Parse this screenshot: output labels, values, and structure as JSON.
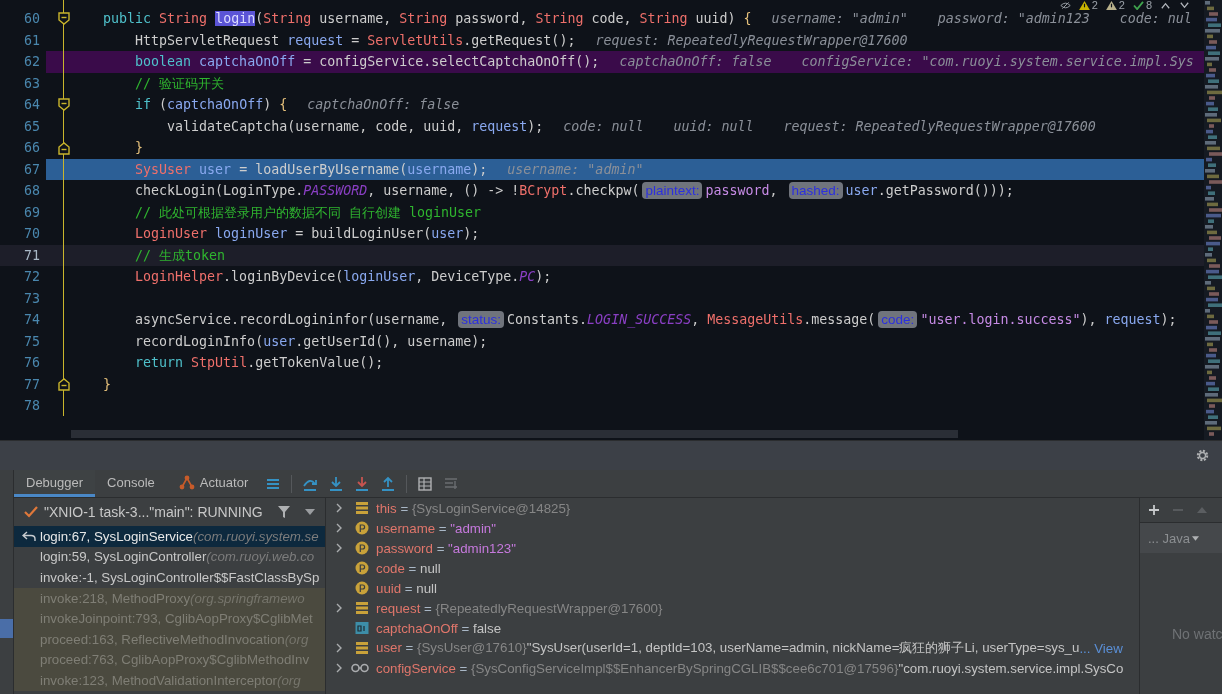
{
  "editor": {
    "inspections": [
      {
        "kind": "warning",
        "count": "2"
      },
      {
        "kind": "weak",
        "count": "2"
      },
      {
        "kind": "ok",
        "count": "8"
      }
    ],
    "lines": [
      {
        "number": "60",
        "fold_marker": {
          "kind": "start"
        },
        "segments": [
          {
            "kind": "code",
            "tokens": [
              {
                "text": "    public ",
                "kind": "kw"
              },
              {
                "text": "String ",
                "kind": "type"
              },
              {
                "text": "login",
                "kind": "sel"
              },
              {
                "text": "(",
                "kind": "p"
              },
              {
                "text": "String",
                "kind": "type"
              },
              {
                "text": " username, ",
                "kind": "p"
              },
              {
                "text": "String",
                "kind": "type"
              },
              {
                "text": " password, ",
                "kind": "p"
              },
              {
                "text": "String",
                "kind": "type"
              },
              {
                "text": " code, ",
                "kind": "p"
              },
              {
                "text": "String",
                "kind": "type"
              },
              {
                "text": " uuid) ",
                "kind": "p"
              },
              {
                "text": "{",
                "kind": "brace"
              }
            ]
          },
          {
            "kind": "value",
            "text": "username: \"admin\""
          },
          {
            "kind": "value",
            "text": "password: \"admin123"
          },
          {
            "kind": "value",
            "text": "code: nul"
          }
        ]
      },
      {
        "number": "61",
        "segments": [
          {
            "kind": "code",
            "tokens": [
              {
                "text": "        HttpServletRequest ",
                "kind": "p"
              },
              {
                "text": "request",
                "kind": "var"
              },
              {
                "text": " = ",
                "kind": "p"
              },
              {
                "text": "ServletUtils",
                "kind": "type"
              },
              {
                "text": ".getRequest();",
                "kind": "p"
              }
            ]
          },
          {
            "kind": "value",
            "text": "request: RepeatedlyRequestWrapper@17600"
          }
        ]
      },
      {
        "number": "62",
        "highlight": {
          "kind": "breakpoint"
        },
        "segments": [
          {
            "kind": "code",
            "tokens": [
              {
                "text": "        boolean ",
                "kind": "kw"
              },
              {
                "text": "captchaOnOff",
                "kind": "var"
              },
              {
                "text": " = configService.selectCaptchaOnOff();",
                "kind": "p"
              }
            ]
          },
          {
            "kind": "value",
            "text": "captchaOnOff: false"
          },
          {
            "kind": "value",
            "text": "configService: \"com.ruoyi.system.service.impl.Sys"
          }
        ]
      },
      {
        "number": "63",
        "segments": [
          {
            "kind": "code",
            "tokens": [
              {
                "text": "        // 验证码开关",
                "kind": "comment"
              }
            ]
          }
        ]
      },
      {
        "number": "64",
        "fold_marker": {
          "kind": "start"
        },
        "segments": [
          {
            "kind": "code",
            "tokens": [
              {
                "text": "        if",
                "kind": "kw"
              },
              {
                "text": " (",
                "kind": "p"
              },
              {
                "text": "captchaOnOff",
                "kind": "var"
              },
              {
                "text": ") ",
                "kind": "p"
              },
              {
                "text": "{",
                "kind": "brace"
              }
            ]
          },
          {
            "kind": "value",
            "text": "captchaOnOff: false"
          }
        ]
      },
      {
        "number": "65",
        "segments": [
          {
            "kind": "code",
            "tokens": [
              {
                "text": "            validateCaptcha(username, code, uuid, ",
                "kind": "p"
              },
              {
                "text": "request",
                "kind": "var"
              },
              {
                "text": ");",
                "kind": "p"
              }
            ]
          },
          {
            "kind": "value",
            "text": "code: null"
          },
          {
            "kind": "value",
            "text": "uuid: null"
          },
          {
            "kind": "value",
            "text": "request: RepeatedlyRequestWrapper@17600"
          }
        ]
      },
      {
        "number": "66",
        "fold_marker": {
          "kind": "end"
        },
        "segments": [
          {
            "kind": "code",
            "tokens": [
              {
                "text": "        }",
                "kind": "brace"
              }
            ]
          }
        ]
      },
      {
        "number": "67",
        "highlight": {
          "kind": "execution"
        },
        "segments": [
          {
            "kind": "code",
            "tokens": [
              {
                "text": "        SysUser ",
                "kind": "type"
              },
              {
                "text": "user",
                "kind": "var"
              },
              {
                "text": " = loadUserByUsername(",
                "kind": "p"
              },
              {
                "text": "username",
                "kind": "var"
              },
              {
                "text": ");",
                "kind": "p"
              }
            ]
          },
          {
            "kind": "value",
            "text": "username: \"admin\""
          }
        ]
      },
      {
        "number": "68",
        "segments": [
          {
            "kind": "code",
            "tokens": [
              {
                "text": "        checkLogin(LoginType.",
                "kind": "p"
              },
              {
                "text": "PASSWORD",
                "kind": "const"
              },
              {
                "text": ", username, () -> !",
                "kind": "p"
              },
              {
                "text": "BCrypt",
                "kind": "type"
              },
              {
                "text": ".checkpw(",
                "kind": "p"
              }
            ]
          },
          {
            "kind": "hint",
            "text": "plaintext:"
          },
          {
            "kind": "code",
            "tokens": [
              {
                "text": "password",
                "kind": "str"
              },
              {
                "text": ", ",
                "kind": "p"
              }
            ]
          },
          {
            "kind": "hint",
            "text": "hashed:"
          },
          {
            "kind": "code",
            "tokens": [
              {
                "text": "user",
                "kind": "var"
              },
              {
                "text": ".getPassword()));",
                "kind": "p"
              }
            ]
          }
        ]
      },
      {
        "number": "69",
        "segments": [
          {
            "kind": "code",
            "tokens": [
              {
                "text": "        // 此处可根据登录用户的数据不同 自行创建 loginUser",
                "kind": "comment"
              }
            ]
          }
        ]
      },
      {
        "number": "70",
        "segments": [
          {
            "kind": "code",
            "tokens": [
              {
                "text": "        LoginUser ",
                "kind": "type"
              },
              {
                "text": "loginUser",
                "kind": "var"
              },
              {
                "text": " = buildLoginUser(",
                "kind": "p"
              },
              {
                "text": "user",
                "kind": "var"
              },
              {
                "text": ");",
                "kind": "p"
              }
            ]
          }
        ]
      },
      {
        "number": "71",
        "highlight": {
          "kind": "caret"
        },
        "segments": [
          {
            "kind": "code",
            "tokens": [
              {
                "text": "        // 生成token",
                "kind": "comment"
              }
            ]
          }
        ]
      },
      {
        "number": "72",
        "segments": [
          {
            "kind": "code",
            "tokens": [
              {
                "text": "        LoginHelper",
                "kind": "type"
              },
              {
                "text": ".loginByDevice(",
                "kind": "p"
              },
              {
                "text": "loginUser",
                "kind": "var"
              },
              {
                "text": ", DeviceType.",
                "kind": "p"
              },
              {
                "text": "PC",
                "kind": "const"
              },
              {
                "text": ");",
                "kind": "p"
              }
            ]
          }
        ]
      },
      {
        "number": "73"
      },
      {
        "number": "74",
        "segments": [
          {
            "kind": "code",
            "tokens": [
              {
                "text": "        asyncService.recordLogininfor(username, ",
                "kind": "p"
              }
            ]
          },
          {
            "kind": "hint",
            "text": "status:"
          },
          {
            "kind": "code",
            "tokens": [
              {
                "text": "Constants.",
                "kind": "p"
              },
              {
                "text": "LOGIN_SUCCESS",
                "kind": "const"
              },
              {
                "text": ", ",
                "kind": "p"
              },
              {
                "text": "MessageUtils",
                "kind": "type"
              },
              {
                "text": ".message(",
                "kind": "p"
              }
            ]
          },
          {
            "kind": "hint",
            "text": "code:"
          },
          {
            "kind": "code",
            "tokens": [
              {
                "text": "\"user.login.success\"",
                "kind": "str"
              },
              {
                "text": "), ",
                "kind": "p"
              },
              {
                "text": "request",
                "kind": "var"
              },
              {
                "text": ");",
                "kind": "p"
              }
            ]
          }
        ]
      },
      {
        "number": "75",
        "segments": [
          {
            "kind": "code",
            "tokens": [
              {
                "text": "        recordLoginInfo(",
                "kind": "p"
              },
              {
                "text": "user",
                "kind": "var"
              },
              {
                "text": ".getUserId(), username);",
                "kind": "p"
              }
            ]
          }
        ]
      },
      {
        "number": "76",
        "segments": [
          {
            "kind": "code",
            "tokens": [
              {
                "text": "        return ",
                "kind": "kw"
              },
              {
                "text": "StpUtil",
                "kind": "type"
              },
              {
                "text": ".getTokenValue();",
                "kind": "p"
              }
            ]
          }
        ]
      },
      {
        "number": "77",
        "fold_marker": {
          "kind": "end"
        },
        "segments": [
          {
            "kind": "code",
            "tokens": [
              {
                "text": "    }",
                "kind": "brace"
              }
            ]
          }
        ]
      },
      {
        "number": "78"
      }
    ]
  },
  "debug": {
    "tabs": [
      {
        "label": "Debugger",
        "selected": true
      },
      {
        "label": "Console",
        "selected": false
      },
      {
        "label": "Actuator",
        "selected": false,
        "kind": "actuator"
      }
    ],
    "thread": "\"XNIO-1 task-3...\"main\": RUNNING",
    "frames": [
      {
        "method": "login:67, SysLoginService",
        "package": "(com.ruoyi.system.se",
        "selected": true,
        "library": false
      },
      {
        "method": "login:59, SysLoginController",
        "package": "(com.ruoyi.web.co",
        "selected": false,
        "library": false
      },
      {
        "method": "invoke:-1, SysLoginController$$FastClassBySp",
        "selected": false,
        "library": false
      },
      {
        "method": "invoke:218, MethodProxy",
        "package": "(org.springframewo",
        "selected": false,
        "library": true
      },
      {
        "method": "invokeJoinpoint:793, CglibAopProxy$CglibMet",
        "selected": false,
        "library": true
      },
      {
        "method": "proceed:163, ReflectiveMethodInvocation",
        "package": "(org",
        "selected": false,
        "library": true
      },
      {
        "method": "proceed:763, CglibAopProxy$CglibMethodInv",
        "selected": false,
        "library": true
      },
      {
        "method": "invoke:123, MethodValidationInterceptor",
        "package": "(org",
        "selected": false,
        "library": true
      }
    ],
    "variables": [
      {
        "kind": "field",
        "expandable": true,
        "name": "this",
        "operator": "=",
        "ref": "{SysLoginService@14825}"
      },
      {
        "kind": "param",
        "expandable": true,
        "name": "username",
        "operator": "=",
        "value": {
          "text": "\"admin\"",
          "kind": "string"
        }
      },
      {
        "kind": "param",
        "expandable": true,
        "name": "password",
        "operator": "=",
        "value": {
          "text": "\"admin123\"",
          "kind": "string"
        }
      },
      {
        "kind": "param",
        "expandable": false,
        "name": "code",
        "operator": "=",
        "value": {
          "text": "null",
          "kind": "plain"
        }
      },
      {
        "kind": "param",
        "expandable": false,
        "name": "uuid",
        "operator": "=",
        "value": {
          "text": "null",
          "kind": "plain"
        }
      },
      {
        "kind": "field",
        "expandable": true,
        "name": "request",
        "operator": "=",
        "ref": "{RepeatedlyRequestWrapper@17600}"
      },
      {
        "kind": "primitive",
        "expandable": false,
        "name": "captchaOnOff",
        "operator": "=",
        "value": {
          "text": "false",
          "kind": "plain"
        }
      },
      {
        "kind": "field",
        "expandable": true,
        "name": "user",
        "operator": "=",
        "ref": "{SysUser@17610}",
        "value": {
          "text": "\"SysUser(userId=1, deptId=103, userName=admin, nickName=疯狂的狮子Li, userType=sys_u",
          "kind": "plain"
        },
        "link": "... View"
      },
      {
        "kind": "watch",
        "expandable": true,
        "name": "configService",
        "operator": "=",
        "ref": "{SysConfigServiceImpl$$EnhancerBySpringCGLIB$$cee6c701@17596}",
        "value": {
          "text": "\"com.ruoyi.system.service.impl.SysCo",
          "kind": "plain"
        }
      }
    ],
    "watches": {
      "language": "... Java",
      "empty_text": "No watc"
    }
  }
}
